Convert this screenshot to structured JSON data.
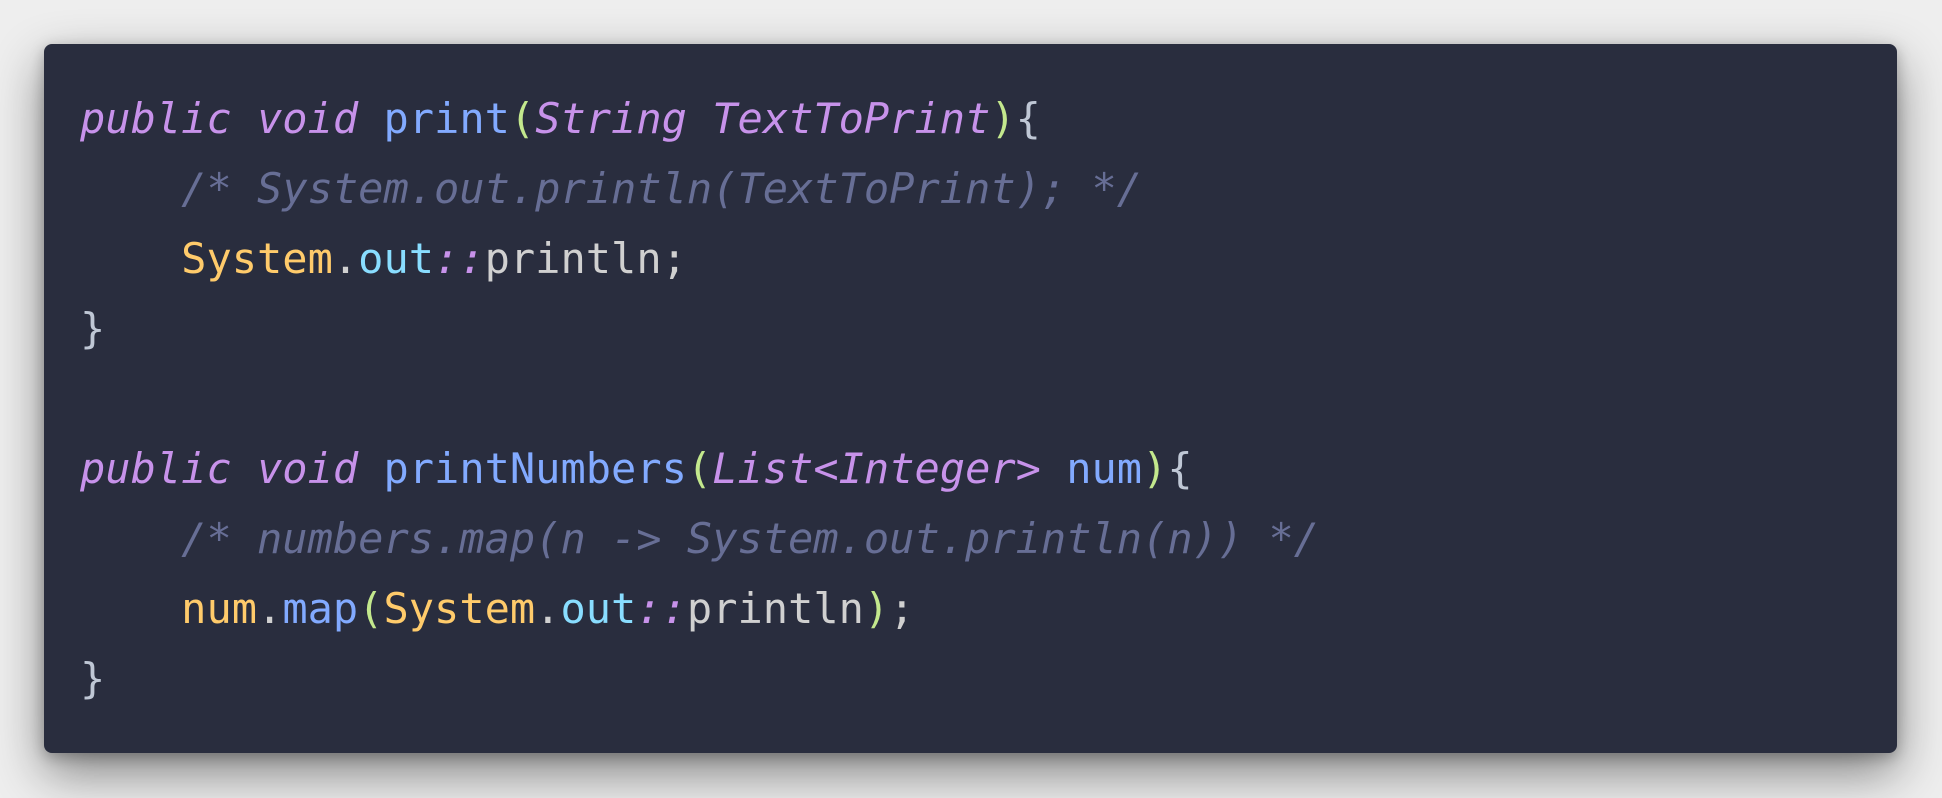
{
  "colors": {
    "background": "#eeeeee",
    "editor_background": "#292d3e",
    "keyword": "#c792ea",
    "function": "#82aaff",
    "comment": "#676e95",
    "class": "#ffcb6b",
    "property": "#89ddff",
    "paren": "#c3e88d",
    "plain": "#d0d0d0"
  },
  "code": {
    "l1": {
      "kw1": "public",
      "kw2": "void",
      "fn": "print",
      "open": "(",
      "type": "String",
      "param": "TextToPrint",
      "close": ")",
      "brace": "{"
    },
    "l2": {
      "comment": "/* System.out.println(TextToPrint); */"
    },
    "l3": {
      "cls": "System",
      "dot": ".",
      "prop": "out",
      "op": "::",
      "method": "println",
      "semi": ";"
    },
    "l4": {
      "brace": "}"
    },
    "l6": {
      "kw1": "public",
      "kw2": "void",
      "fn": "printNumbers",
      "open": "(",
      "type": "List<Integer>",
      "param": "num",
      "close": ")",
      "brace": "{"
    },
    "l7": {
      "comment": "/* numbers.map(n -> System.out.println(n)) */"
    },
    "l8": {
      "obj": "num",
      "dot1": ".",
      "fn": "map",
      "open": "(",
      "cls": "System",
      "dot2": ".",
      "prop": "out",
      "op": "::",
      "method": "println",
      "close": ")",
      "semi": ";"
    },
    "l9": {
      "brace": "}"
    }
  }
}
